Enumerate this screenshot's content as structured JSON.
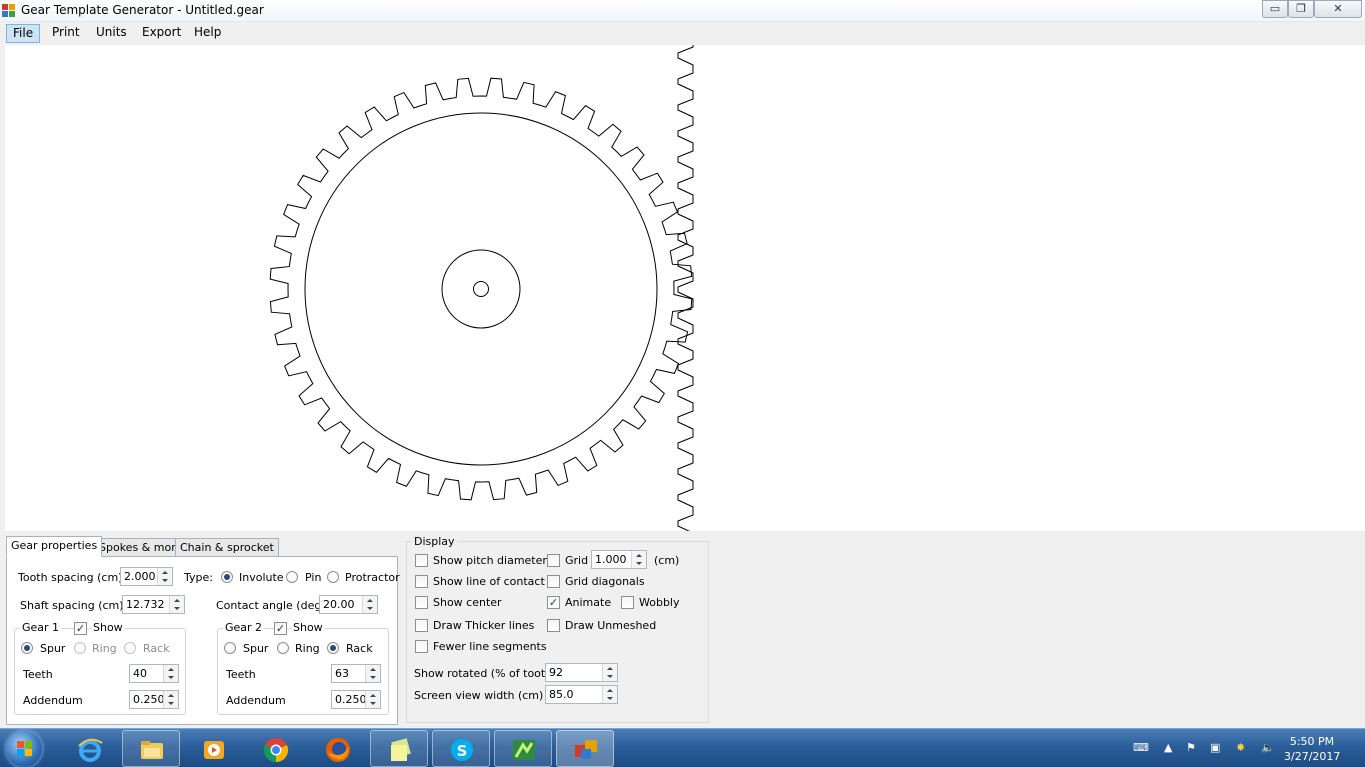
{
  "window": {
    "title": "Gear Template Generator - Untitled.gear",
    "minimize": "▭",
    "maximize": "❐",
    "close": "✕"
  },
  "menu": [
    "File",
    "Print",
    "Units",
    "Export",
    "Help"
  ],
  "tabs": [
    "Gear properties",
    "Spokes & more",
    "Chain & sprocket"
  ],
  "gear_props": {
    "tooth_spacing_label": "Tooth spacing (cm)",
    "tooth_spacing": "2.000",
    "type_label": "Type:",
    "type_options": [
      "Involute",
      "Pin",
      "Protractor"
    ],
    "type_selected": "Involute",
    "shaft_spacing_label": "Shaft spacing (cm)",
    "shaft_spacing": "12.732",
    "contact_angle_label": "Contact angle (deg)",
    "contact_angle": "20.00"
  },
  "gear1": {
    "title": "Gear 1",
    "show_label": "Show",
    "show": true,
    "kinds": [
      "Spur",
      "Ring",
      "Rack"
    ],
    "kind_selected": "Spur",
    "teeth_label": "Teeth",
    "teeth": "40",
    "addendum_label": "Addendum",
    "addendum": "0.250"
  },
  "gear2": {
    "title": "Gear 2",
    "show_label": "Show",
    "show": true,
    "kinds": [
      "Spur",
      "Ring",
      "Rack"
    ],
    "kind_selected": "Rack",
    "teeth_label": "Teeth",
    "teeth": "63",
    "addendum_label": "Addendum",
    "addendum": "0.250"
  },
  "display": {
    "title": "Display",
    "show_pitch_diameter": {
      "label": "Show pitch diameter",
      "checked": false
    },
    "show_line_of_contact": {
      "label": "Show line of contact",
      "checked": false
    },
    "show_center": {
      "label": "Show center",
      "checked": false
    },
    "draw_thicker_lines": {
      "label": "Draw Thicker lines",
      "checked": false
    },
    "fewer_line_segments": {
      "label": "Fewer line segments",
      "checked": false
    },
    "grid": {
      "label": "Grid",
      "checked": false,
      "value": "1.000",
      "unit": "(cm)"
    },
    "grid_diagonals": {
      "label": "Grid diagonals",
      "checked": false
    },
    "animate": {
      "label": "Animate",
      "checked": true
    },
    "wobbly": {
      "label": "Wobbly",
      "checked": false
    },
    "draw_unmeshed": {
      "label": "Draw Unmeshed",
      "checked": false
    },
    "show_rotated_label": "Show rotated (% of tooth)",
    "show_rotated": "92",
    "screen_width_label": "Screen view width (cm)",
    "screen_width": "85.0"
  },
  "taskbar": {
    "apps": [
      "internet-explorer",
      "file-explorer",
      "media-player",
      "chrome",
      "firefox",
      "sticky-notes",
      "skype",
      "spreadsheet",
      "gear-generator"
    ],
    "clock_time": "5:50 PM",
    "clock_date": "3/27/2017"
  },
  "colors": {
    "taskbar": "#2c5e99",
    "accent": "#264b80",
    "canvas": "#ffffff"
  }
}
